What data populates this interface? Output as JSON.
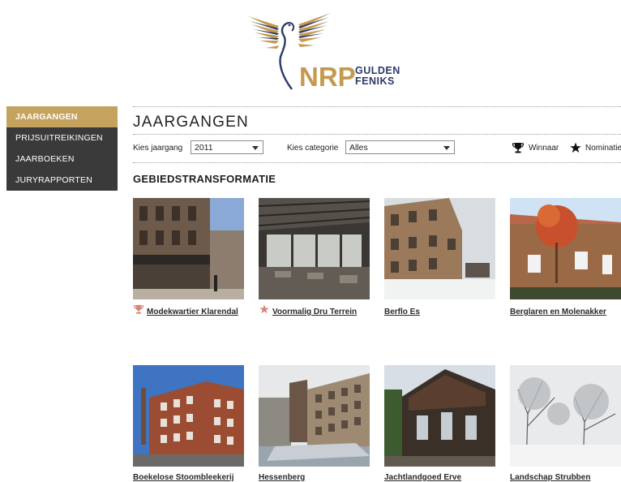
{
  "logo": {
    "brand": "NRP",
    "subtitle_line1": "GULDEN",
    "subtitle_line2": "FENIKS"
  },
  "sidebar": {
    "items": [
      {
        "label": "JAARGANGEN",
        "active": true
      },
      {
        "label": "PRIJSUITREIKINGEN",
        "active": false
      },
      {
        "label": "JAARBOEKEN",
        "active": false
      },
      {
        "label": "JURYRAPPORTEN",
        "active": false
      }
    ]
  },
  "main": {
    "title": "JAARGANGEN",
    "filters": {
      "year_label": "Kies jaargang",
      "year_value": "2011",
      "category_label": "Kies categorie",
      "category_value": "Alles"
    },
    "legend": {
      "winner": "Winnaar",
      "nomination": "Nominatie"
    },
    "section_title": "GEBIEDSTRANSFORMATIE",
    "projects": [
      {
        "title": "Modekwartier Klarendal",
        "badge": "trophy"
      },
      {
        "title": "Voormalig Dru Terrein",
        "badge": "star"
      },
      {
        "title": "Berflo Es",
        "badge": ""
      },
      {
        "title": "Berglaren en Molenakker",
        "badge": ""
      },
      {
        "title": "Boekelose Stoombleekerij",
        "badge": ""
      },
      {
        "title": "Hessenberg",
        "badge": ""
      },
      {
        "title": "Jachtlandgoed Erve",
        "badge": ""
      },
      {
        "title": "Landschap Strubben",
        "badge": ""
      }
    ]
  },
  "colors": {
    "accent_gold": "#c5a35e",
    "sidebar_dark": "#3a3a3a",
    "navy": "#2b3a67",
    "badge_red": "#d9837a"
  }
}
